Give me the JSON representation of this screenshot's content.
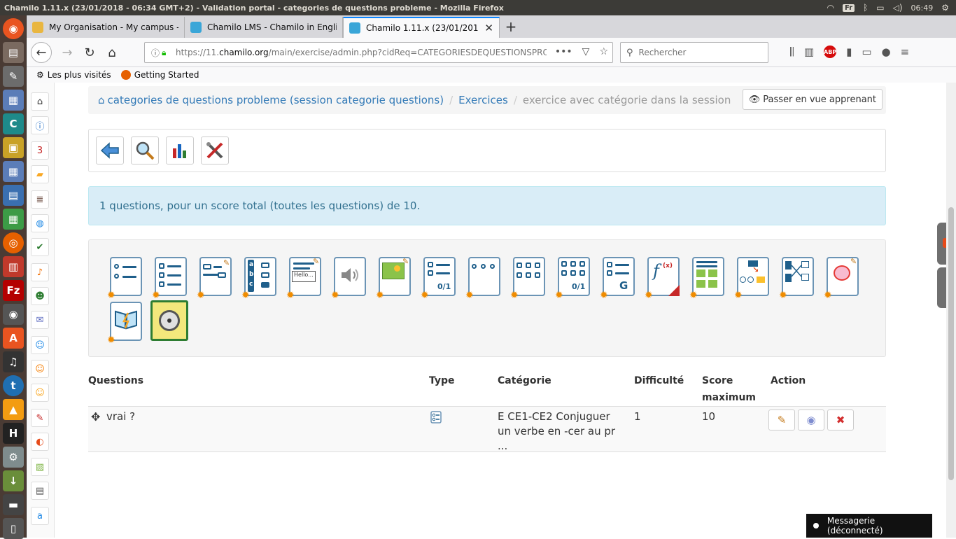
{
  "os": {
    "window_title": "Chamilo 1.11.x (23/01/2018 - 06:34 GMT+2) - Validation portal - categories de questions probleme - Mozilla Firefox",
    "keyboard_layout": "Fr",
    "clock": "06:49"
  },
  "browser": {
    "tabs": [
      {
        "label": "My Organisation - My campus - I",
        "active": false
      },
      {
        "label": "Chamilo LMS - Chamilo in English",
        "active": false
      },
      {
        "label": "Chamilo 1.11.x (23/01/2018 - 06:3",
        "active": true
      }
    ],
    "url_prefix": "https://11.",
    "url_host": "chamilo.org",
    "url_path": "/main/exercise/admin.php?cidReq=CATEGORIESDEQUESTIONSPROBLEME&i",
    "search_placeholder": "Rechercher",
    "bookmarks": [
      "Les plus visités",
      "Getting Started"
    ]
  },
  "breadcrumb": {
    "course": "categories de questions probleme (session categorie questions)",
    "exercises": "Exercices",
    "current": "exercice avec catégorie dans la session",
    "student_view_button": "Passer en vue apprenant"
  },
  "info": {
    "message": "1 questions, pour un score total (toutes les questions) de 10."
  },
  "table": {
    "headers": {
      "questions": "Questions",
      "type": "Type",
      "category": "Catégorie",
      "difficulty": "Difficulté",
      "score_line1": "Score",
      "score_line2": "maximum",
      "action": "Action"
    },
    "rows": [
      {
        "question": "vrai ?",
        "category_line1": "E CE1-CE2 Conjuguer",
        "category_line2": "un verbe en -cer au pr",
        "category_line3": "...",
        "difficulty": "1",
        "score": "10"
      }
    ]
  },
  "chat": {
    "label": "Messagerie (déconnecté)"
  },
  "colors": {
    "link": "#337ab7",
    "alert_bg": "#d9edf7",
    "alert_text": "#31708f",
    "icon_blue": "#1f5f8b"
  }
}
